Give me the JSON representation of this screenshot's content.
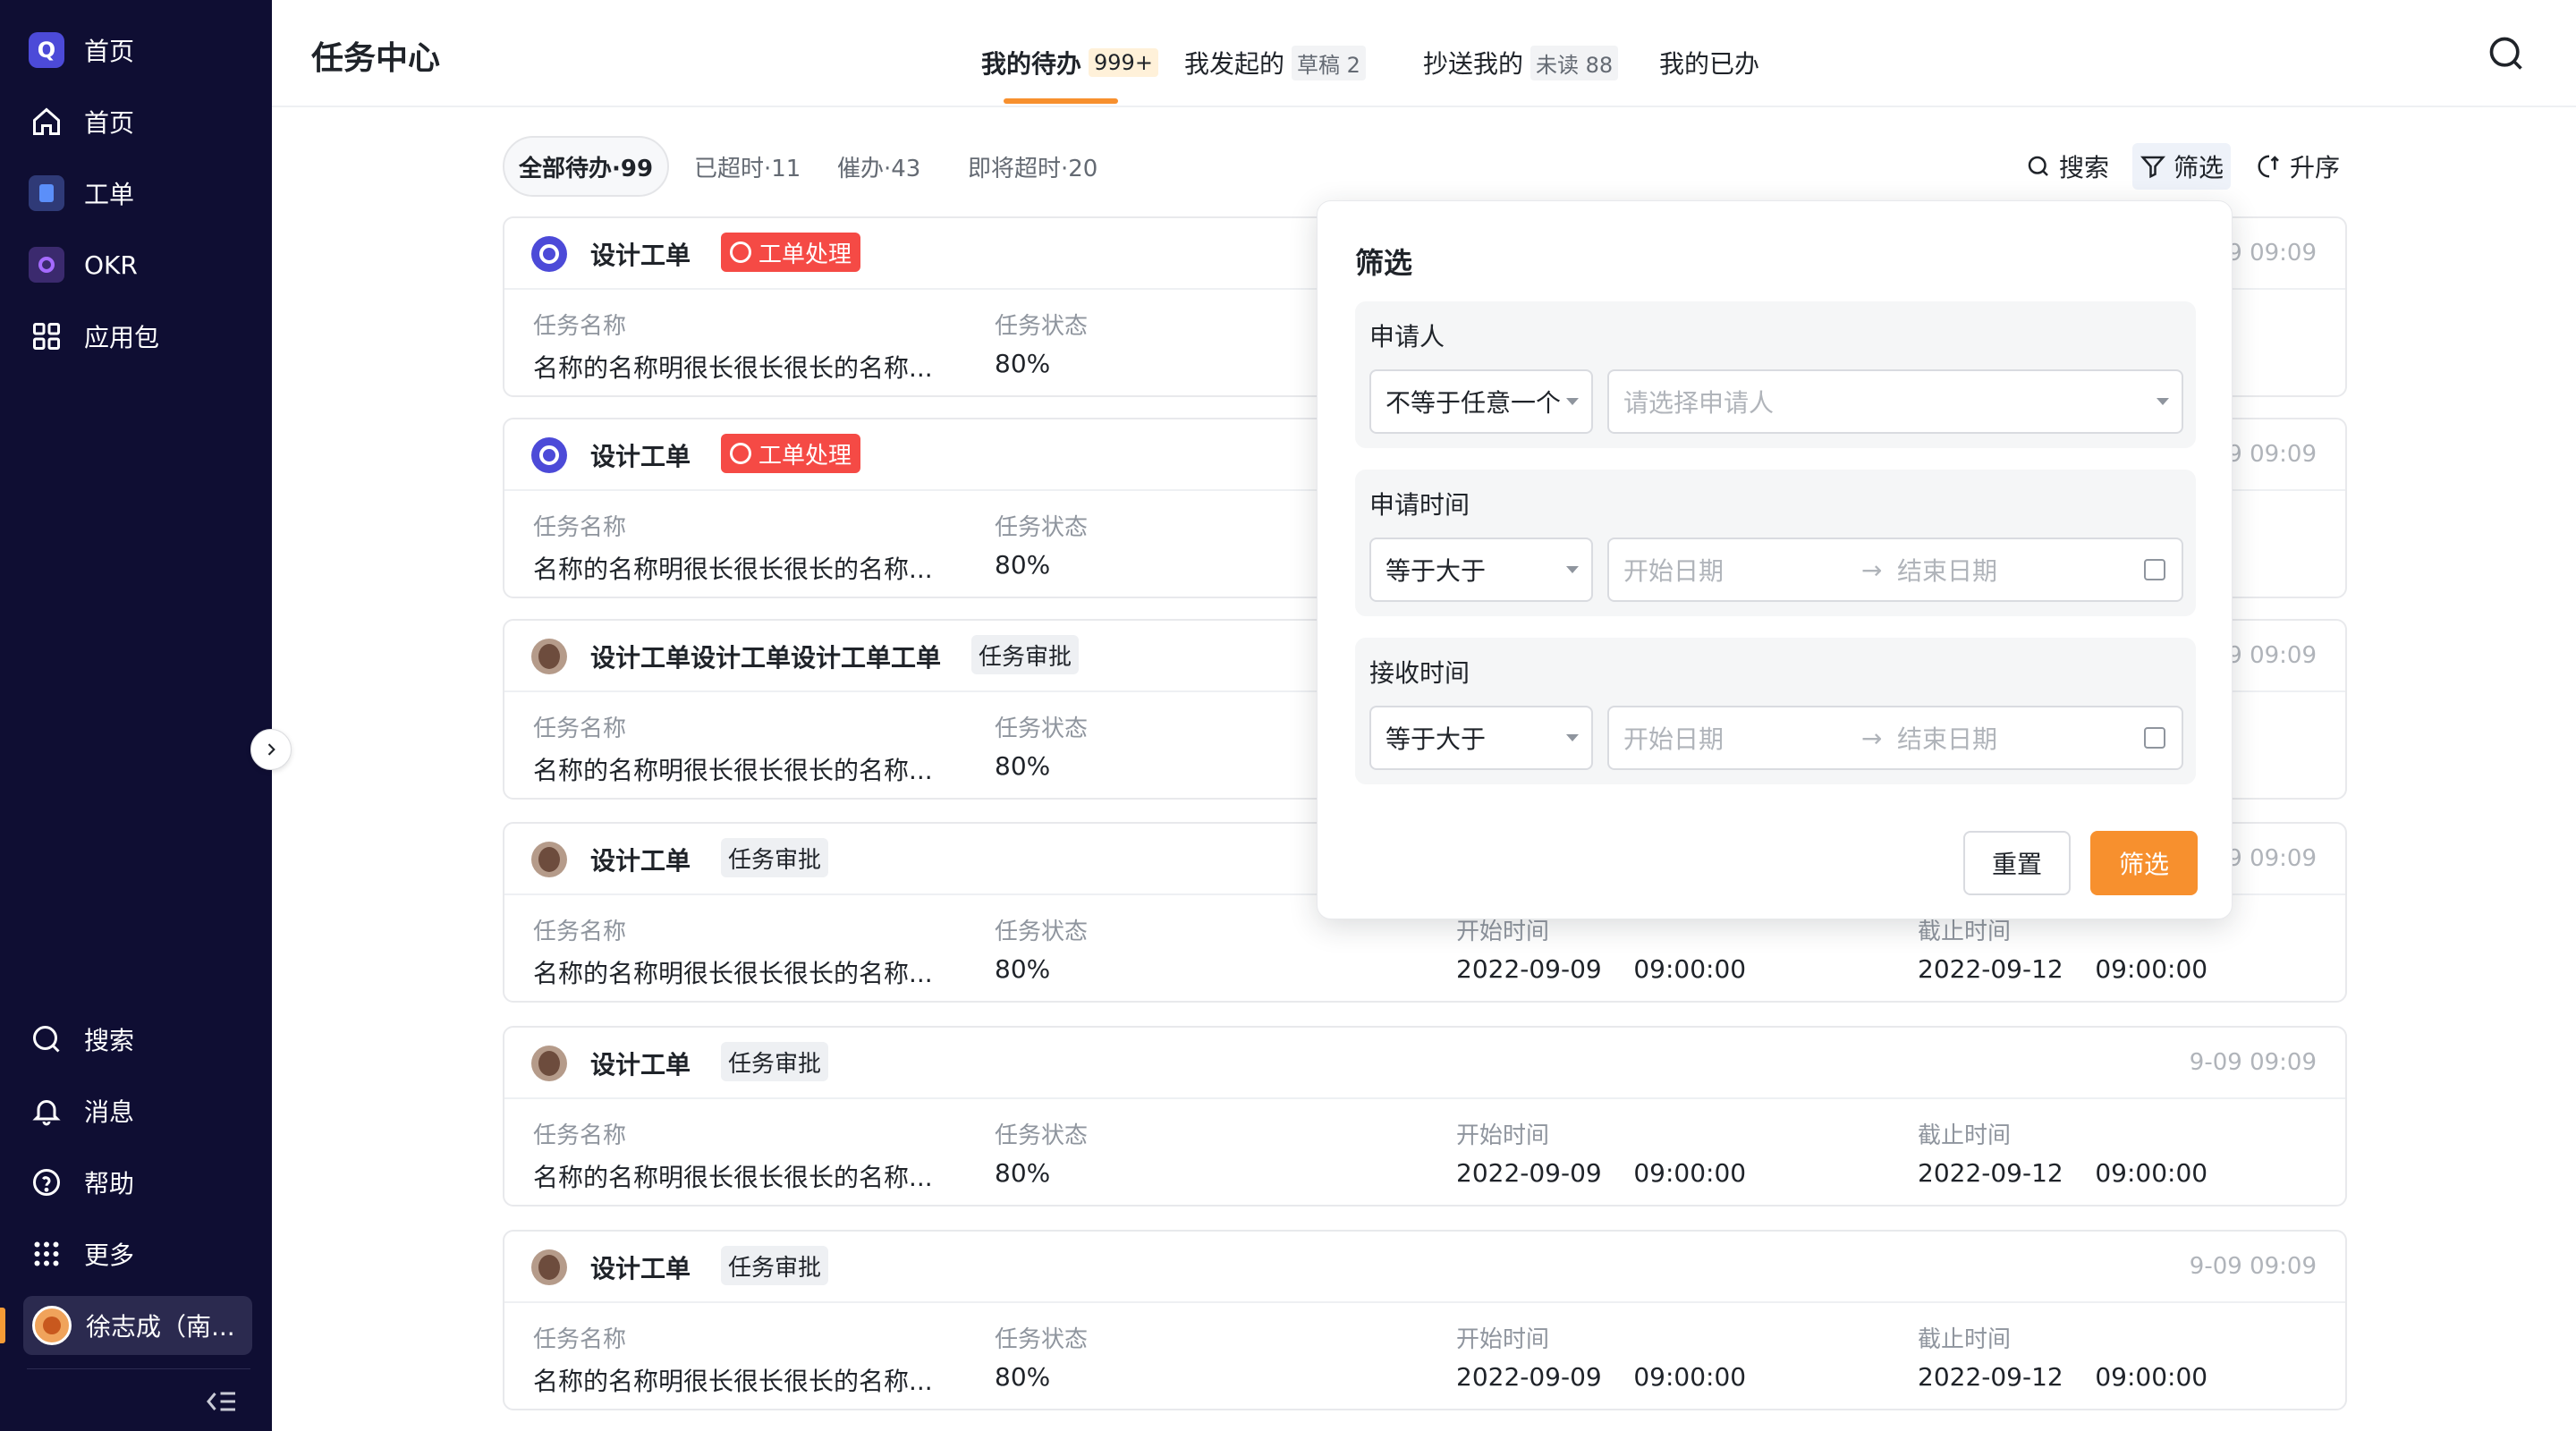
{
  "sidebar": {
    "items": [
      {
        "label": "首页",
        "icon": "app-logo-icon"
      },
      {
        "label": "首页",
        "icon": "home-icon"
      },
      {
        "label": "工单",
        "icon": "document-icon"
      },
      {
        "label": "OKR",
        "icon": "okr-icon"
      },
      {
        "label": "应用包",
        "icon": "grid-icon"
      }
    ],
    "bottom_items": [
      {
        "label": "搜索",
        "icon": "search-icon"
      },
      {
        "label": "消息",
        "icon": "bell-icon"
      },
      {
        "label": "帮助",
        "icon": "help-icon"
      },
      {
        "label": "更多",
        "icon": "dots-grid-icon"
      }
    ],
    "user": {
      "name": "徐志成（南..."
    }
  },
  "header": {
    "title": "任务中心",
    "tabs": [
      {
        "label": "我的待办",
        "badge": "999+",
        "active": true
      },
      {
        "label": "我发起的",
        "badge": "草稿 2"
      },
      {
        "label": "抄送我的",
        "badge": "未读 88"
      },
      {
        "label": "我的已办",
        "badge": ""
      }
    ]
  },
  "filters": {
    "chips": [
      "全部待办·99",
      "已超时·11",
      "催办·43",
      "即将超时·20"
    ],
    "tools": {
      "search": "搜索",
      "filter": "筛选",
      "sort": "升序"
    }
  },
  "field_labels": {
    "name": "任务名称",
    "status": "任务状态",
    "start": "开始时间",
    "end": "截止时间"
  },
  "cards": [
    {
      "title": "设计工单",
      "tag": "工单处理",
      "tag_type": "red",
      "icon": "q",
      "time": "9 09:09",
      "name": "名称的名称明很长很长很长的名称...",
      "status": "80%",
      "start": "",
      "end": ""
    },
    {
      "title": "设计工单",
      "tag": "工单处理",
      "tag_type": "red",
      "icon": "q",
      "time": "9 09:09",
      "name": "名称的名称明很长很长很长的名称...",
      "status": "80%",
      "start": "",
      "end": ""
    },
    {
      "title": "设计工单设计工单设计工单工单",
      "tag": "任务审批",
      "tag_type": "grey",
      "icon": "avatar",
      "time": "9 09:09",
      "name": "名称的名称明很长很长很长的名称...",
      "status": "80%",
      "start": "",
      "end": ""
    },
    {
      "title": "设计工单",
      "tag": "任务审批",
      "tag_type": "grey",
      "icon": "avatar",
      "time": "9 09:09",
      "name": "名称的名称明很长很长很长的名称...",
      "status": "80%",
      "start": "2022-09-09    09:00:00",
      "end": "2022-09-12    09:00:00"
    },
    {
      "title": "设计工单",
      "tag": "任务审批",
      "tag_type": "grey",
      "icon": "avatar",
      "time": "9-09 09:09",
      "name": "名称的名称明很长很长很长的名称...",
      "status": "80%",
      "start": "2022-09-09    09:00:00",
      "end": "2022-09-12    09:00:00"
    },
    {
      "title": "设计工单",
      "tag": "任务审批",
      "tag_type": "grey",
      "icon": "avatar",
      "time": "9-09 09:09",
      "name": "名称的名称明很长很长很长的名称...",
      "status": "80%",
      "start": "2022-09-09    09:00:00",
      "end": "2022-09-12    09:00:00"
    }
  ],
  "popover": {
    "title": "筛选",
    "groups": [
      {
        "label": "申请人",
        "operator": "不等于任意一个",
        "placeholder": "请选择申请人"
      },
      {
        "label": "申请时间",
        "operator": "等于大于",
        "start_placeholder": "开始日期",
        "end_placeholder": "结束日期"
      },
      {
        "label": "接收时间",
        "operator": "等于大于",
        "start_placeholder": "开始日期",
        "end_placeholder": "结束日期"
      }
    ],
    "reset_label": "重置",
    "submit_label": "筛选"
  },
  "colors": {
    "sidebar_bg": "#0f0e33",
    "accent": "#f7902e",
    "tag_red": "#f54a45",
    "brand": "#4c4ad8"
  }
}
